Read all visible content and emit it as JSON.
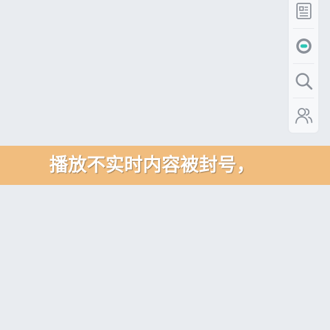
{
  "sidebar": {
    "items": [
      {
        "icon": "article-icon"
      },
      {
        "icon": "toggle-record-icon"
      },
      {
        "icon": "search-icon"
      },
      {
        "icon": "users-icon"
      }
    ]
  },
  "banner": {
    "text": "播放不实时内容被封号，",
    "color": "#f1bd7e"
  },
  "colors": {
    "background": "#e9ecf0",
    "sidebar_bg": "#f7f8fa",
    "icon_gray": "#8a9099",
    "accent_teal": "#2bc5b4"
  }
}
